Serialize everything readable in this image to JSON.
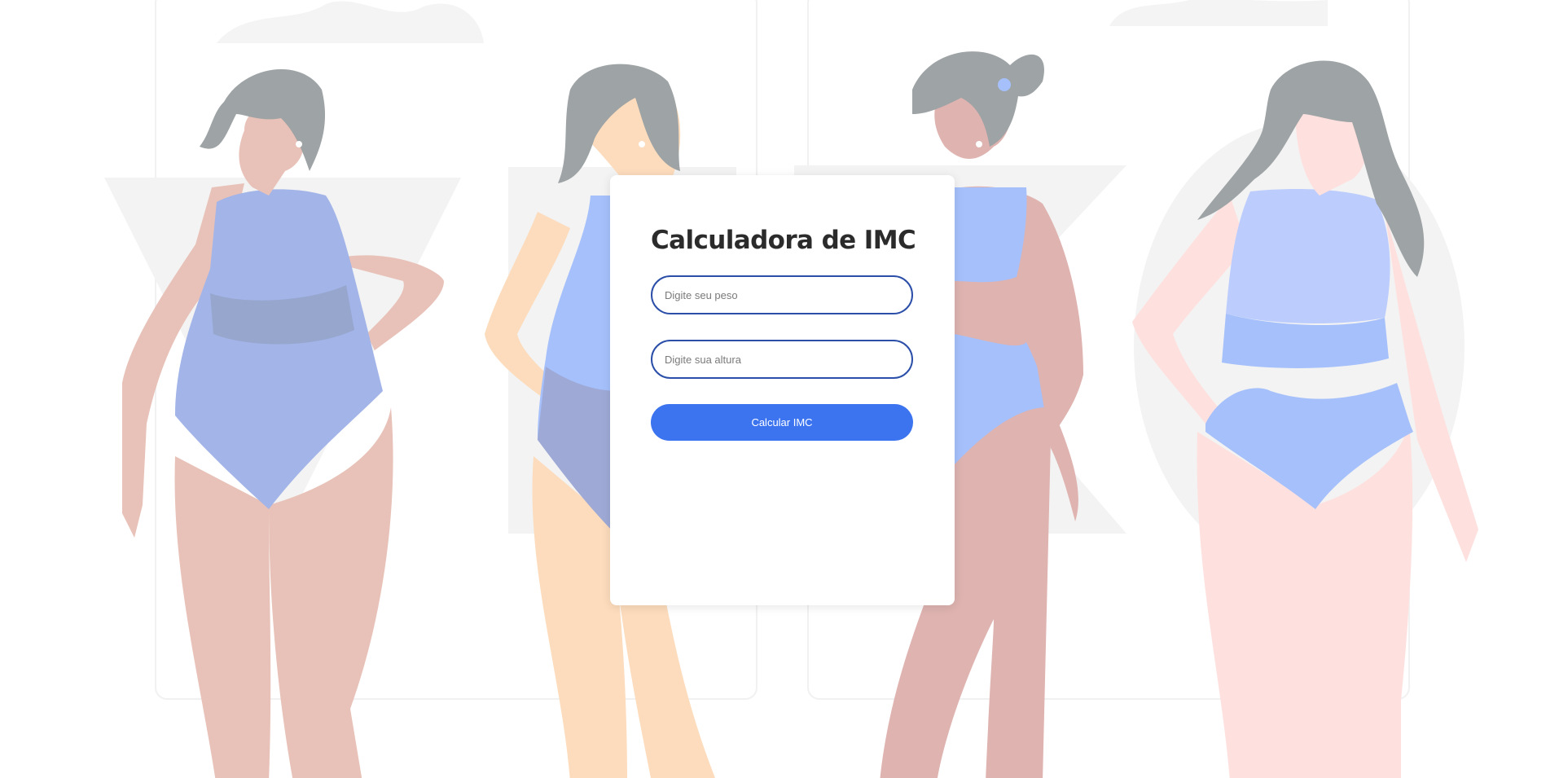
{
  "calculator": {
    "title": "Calculadora de IMC",
    "weight_placeholder": "Digite seu peso",
    "height_placeholder": "Digite sua altura",
    "weight_value": "",
    "height_value": "",
    "submit_label": "Calcular IMC"
  },
  "colors": {
    "accent": "#3c74f0",
    "input_border": "#2b4fa8",
    "title": "#2b2b2b",
    "swimsuit": "#a3bdfa",
    "hair": "#9ea3a5"
  },
  "background": {
    "illustration": "four-women-body-types-illustration",
    "figures": [
      "figure-1",
      "figure-2",
      "figure-3",
      "figure-4"
    ]
  }
}
